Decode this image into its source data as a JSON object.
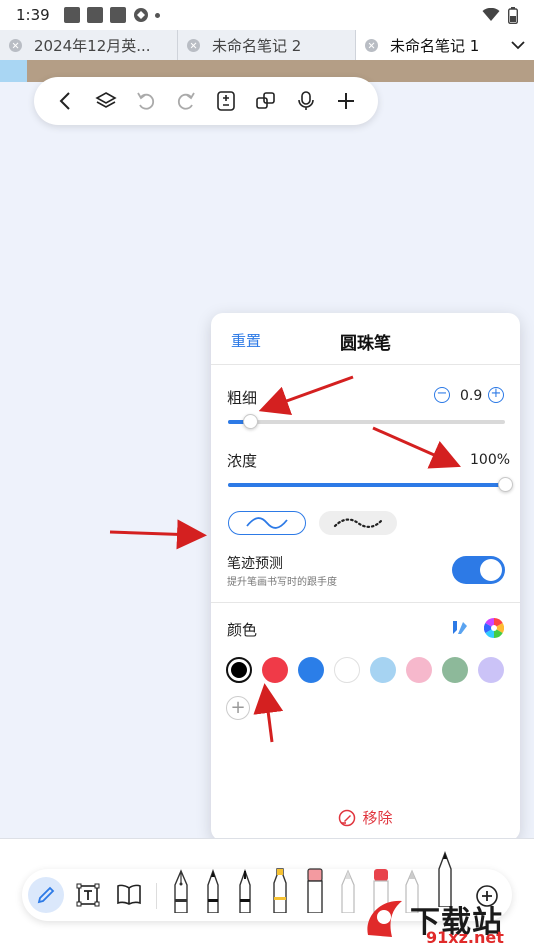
{
  "status_bar": {
    "time": "1:39"
  },
  "tabs": [
    {
      "label": "2024年12月英...",
      "active": false
    },
    {
      "label": "未命名笔记 2",
      "active": false
    },
    {
      "label": "未命名笔记 1",
      "active": true
    }
  ],
  "pen_panel": {
    "reset": "重置",
    "title": "圆珠笔",
    "thickness": {
      "label": "粗细",
      "value": "0.9",
      "minus": "−",
      "plus": "+",
      "slider_fraction": 0.08
    },
    "opacity": {
      "label": "浓度",
      "value": "100%",
      "slider_fraction": 1.0
    },
    "prediction": {
      "label": "笔迹预测",
      "sub": "提升笔画书写时的跟手度",
      "enabled": true
    },
    "color": {
      "label": "颜色",
      "add": "+"
    },
    "swatches": [
      "#000000",
      "#f03a48",
      "#2b7ee8",
      "#ffffff",
      "#a6d3f2",
      "#f6b8cc",
      "#8db99a",
      "#cbc3f7"
    ],
    "remove": "移除"
  },
  "watermark": {
    "text": "下载站",
    "url": "91xz.net"
  },
  "colors": {
    "accent": "#2d7ae6",
    "danger": "#e0353e",
    "arrow": "#d42020"
  }
}
